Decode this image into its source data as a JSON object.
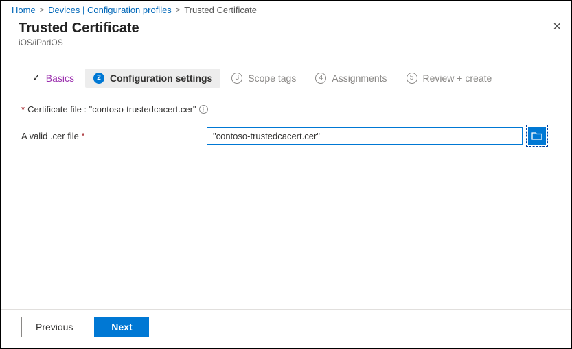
{
  "breadcrumb": {
    "home": "Home",
    "devices": "Devices | Configuration profiles",
    "current": "Trusted Certificate"
  },
  "header": {
    "title": "Trusted Certificate",
    "subtitle": "iOS/iPadOS"
  },
  "steps": {
    "basics": "Basics",
    "config_num": "2",
    "config": "Configuration settings",
    "scope_num": "3",
    "scope": "Scope tags",
    "assign_num": "4",
    "assign": "Assignments",
    "review_num": "5",
    "review": "Review + create"
  },
  "form": {
    "cert_file_label": "Certificate file : \"contoso-trustedcacert.cer\"",
    "valid_cer_label": "A valid .cer file",
    "valid_cer_value": "\"contoso-trustedcacert.cer\""
  },
  "footer": {
    "previous": "Previous",
    "next": "Next"
  }
}
